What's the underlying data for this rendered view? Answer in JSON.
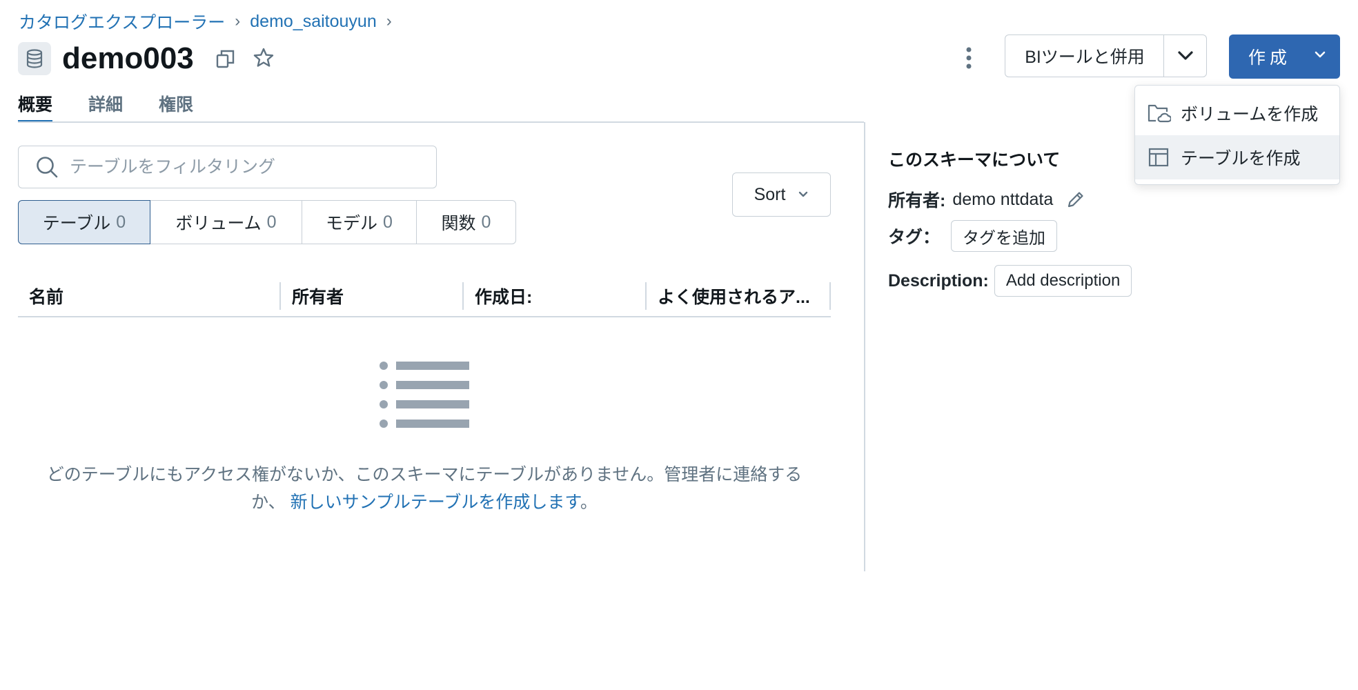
{
  "breadcrumb": {
    "items": [
      "カタログエクスプローラー",
      "demo_saitouyun"
    ],
    "separator": "›"
  },
  "header": {
    "title": "demo003",
    "bi_button_label": "BIツールと併用",
    "create_button_label": "作成"
  },
  "tabs": [
    {
      "label": "概要",
      "active": true
    },
    {
      "label": "詳細",
      "active": false
    },
    {
      "label": "権限",
      "active": false
    }
  ],
  "filter": {
    "placeholder": "テーブルをフィルタリング",
    "value": ""
  },
  "segments": [
    {
      "label": "テーブル",
      "count": "0",
      "selected": true
    },
    {
      "label": "ボリューム",
      "count": "0",
      "selected": false
    },
    {
      "label": "モデル",
      "count": "0",
      "selected": false
    },
    {
      "label": "関数",
      "count": "0",
      "selected": false
    }
  ],
  "sort": {
    "label": "Sort"
  },
  "table": {
    "columns": [
      "名前",
      "所有者",
      "作成日:",
      "よく使用されるア..."
    ],
    "rows": []
  },
  "empty_state": {
    "message": "どのテーブルにもアクセス権がないか、このスキーマにテーブルがありません。管理者に連絡するか、",
    "link_text": "新しいサンプルテーブルを作成します",
    "suffix": "。"
  },
  "about": {
    "title": "このスキーマについて",
    "owner_label": "所有者:",
    "owner_value": "demo nttdata",
    "tag_label": "タグ：",
    "add_tag_label": "タグを追加",
    "description_label": "Description:",
    "add_description_label": "Add description"
  },
  "create_menu": {
    "items": [
      {
        "label": "ボリュームを作成",
        "icon": "cloud-folder-icon"
      },
      {
        "label": "テーブルを作成",
        "icon": "table-icon",
        "hovered": true
      }
    ]
  },
  "colors": {
    "accent": "#2272b4",
    "primary_button": "#2e67b1",
    "selected_segment_bg": "#dfe8f2",
    "border": "#c7cfd6",
    "muted_text": "#5f7281"
  }
}
